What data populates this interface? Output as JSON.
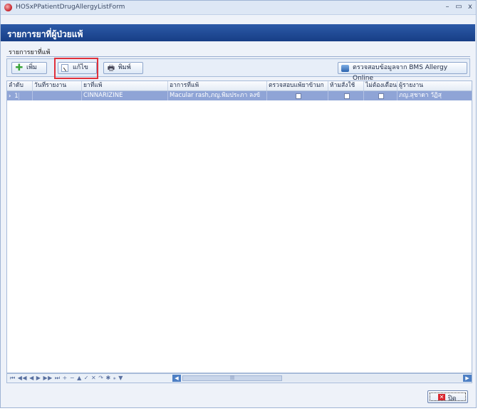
{
  "window": {
    "title": "HOSxPPatientDrugAllergyListForm",
    "minimize": "–",
    "maximize": "▭",
    "close": "x"
  },
  "header": {
    "title": "รายการยาที่ผู้ป่วยแพ้"
  },
  "subheader": {
    "label": "รายการยาที่แพ้"
  },
  "toolbar": {
    "add_label": "เพิ่ม",
    "edit_label": "แก้ไข",
    "print_label": "พิมพ์",
    "bms_label": "ตรวจสอบข้อมูลจาก BMS Allergy Online"
  },
  "grid": {
    "columns": [
      "ลำดับ",
      "วันที่รายงาน",
      "ยาที่แพ้",
      "อาการที่แพ้",
      "ตรวจสอบแพ้ยาข้ามก",
      "ห้ามสั่งใช้",
      "ไม่ต้องเตือน",
      "ผู้รายงาน"
    ],
    "rows": [
      {
        "order": "1",
        "report_date": "",
        "drug": "CINNARIZINE",
        "symptom": "Macular rash,ภญ.พิมประภา ลงข้",
        "cross_check": false,
        "prohibited": false,
        "no_warning": false,
        "reporter": "ภญ.สุชาดา วัฏิสุ"
      }
    ]
  },
  "navigator": {
    "symbols": "⏮ ◀◀ ◀ ▶ ▶▶ ⏭ + − ▲ ✓ ✕ ↷ ✱ ⁎ ▼"
  },
  "footer": {
    "close_label": "ปิด"
  },
  "icons": {
    "add": "plus-icon",
    "edit": "edit-icon",
    "print": "printer-icon",
    "bms": "cloud-check-icon",
    "close": "close-x-icon"
  },
  "colors": {
    "header_bg": "#1f4a95",
    "selected_row": "#8fa4d6",
    "highlight_box": "#e0303a"
  }
}
